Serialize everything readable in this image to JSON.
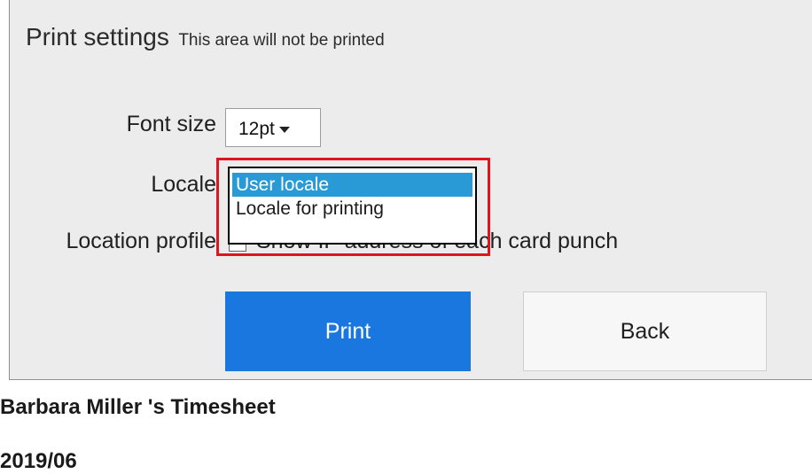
{
  "print_settings": {
    "title": "Print settings",
    "note": "This area will not be printed",
    "font_size": {
      "label": "Font size",
      "value": "12pt"
    },
    "locale": {
      "label": "Locale",
      "options": [
        "User locale",
        "Locale for printing"
      ],
      "selected": "User locale"
    },
    "location_profile": {
      "label": "Location profile",
      "checkbox_label": "Show IP address of each card punch",
      "checked": false
    },
    "print_button": "Print",
    "back_button": "Back"
  },
  "timesheet": {
    "title": "Barbara Miller 's Timesheet",
    "period": "2019/06"
  },
  "colors": {
    "highlight": "#e0141e",
    "primary_button": "#1a77e0",
    "selected_option": "#2a9ad6"
  }
}
